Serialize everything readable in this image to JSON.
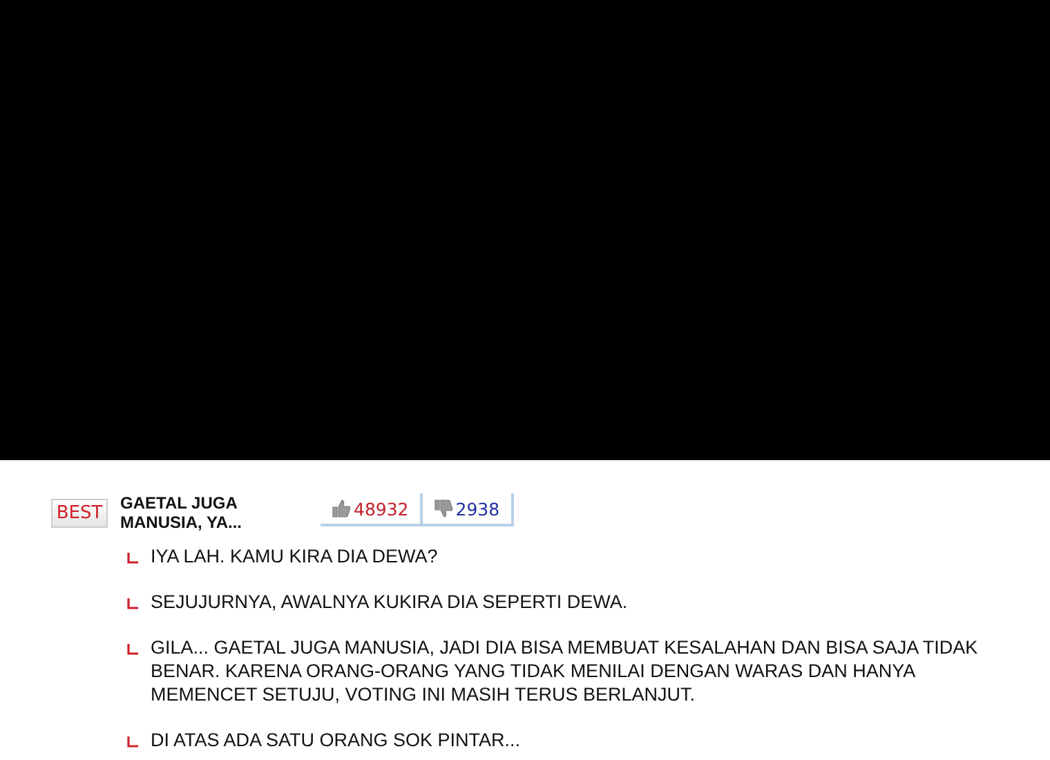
{
  "best_comment": {
    "badge": "BEST",
    "title": "GAETAL JUGA MANUSIA, YA...",
    "likes": "48932",
    "dislikes": "2938"
  },
  "replies": [
    {
      "text": "IYA LAH. KAMU KIRA DIA DEWA?"
    },
    {
      "text": "SEJUJURNYA, AWALNYA KUKIRA DIA SEPERTI DEWA."
    },
    {
      "text": "GILA... GAETAL JUGA MANUSIA, JADI DIA BISA MEMBUAT KESALAHAN DAN BISA SAJA TIDAK BENAR. KARENA ORANG-ORANG YANG TIDAK MENILAI DENGAN WARAS DAN HANYA MEMENCET SETUJU, VOTING INI MASIH TERUS BERLANJUT."
    },
    {
      "text": "DI ATAS ADA SATU ORANG SOK PINTAR..."
    }
  ]
}
